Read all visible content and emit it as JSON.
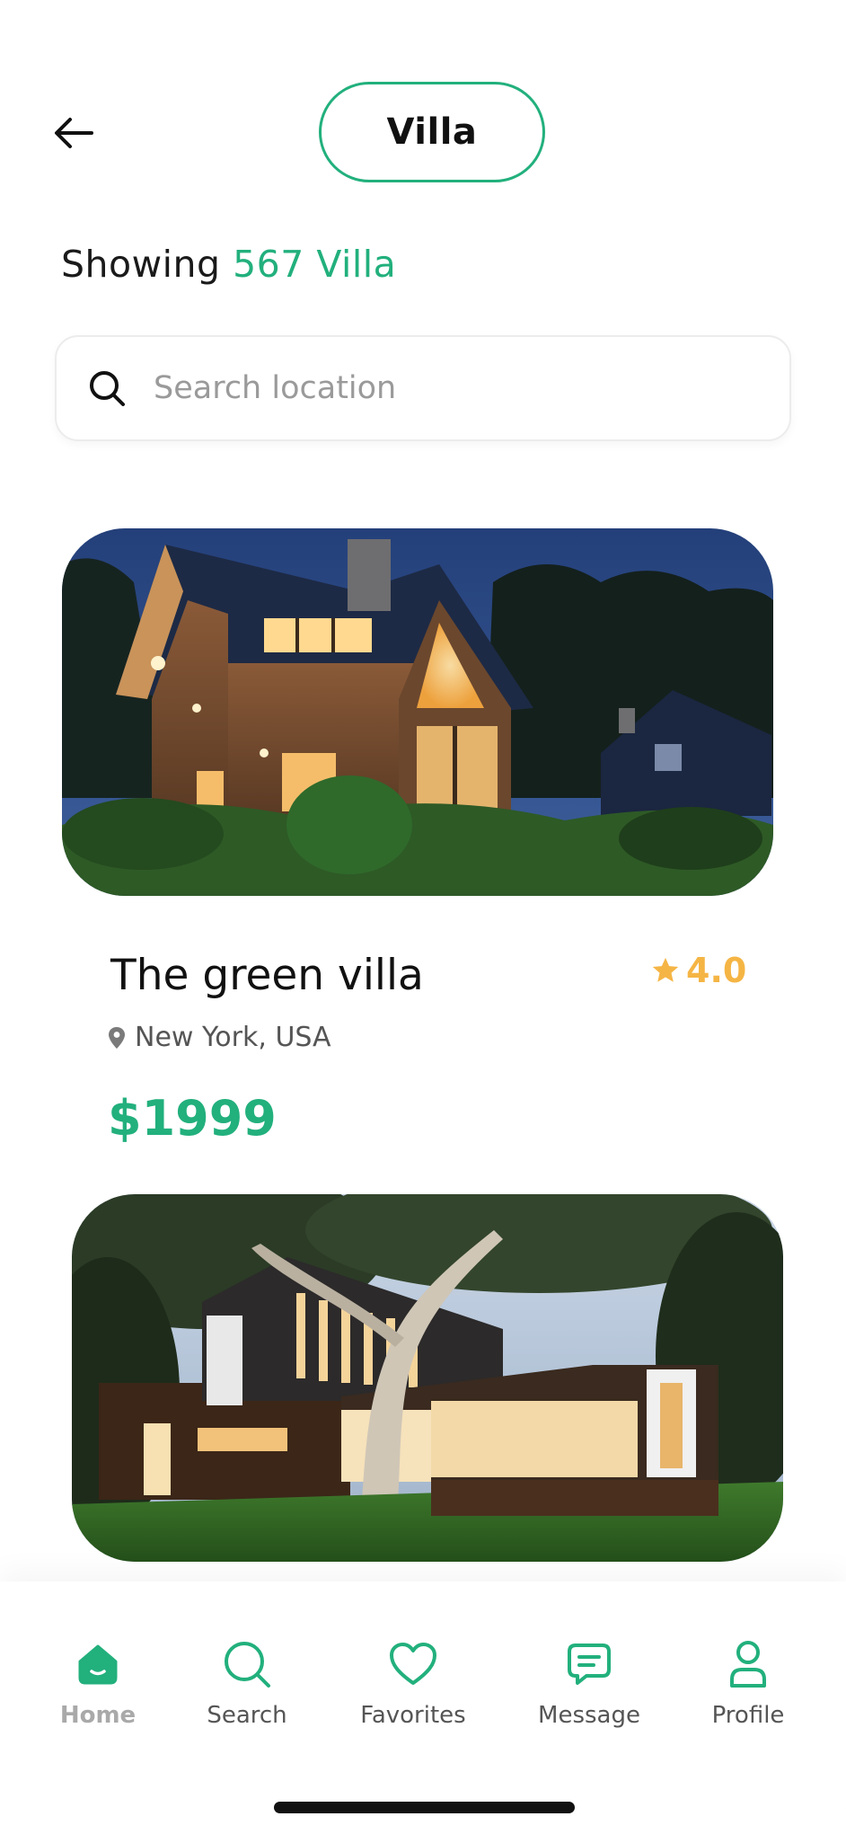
{
  "header": {
    "title": "Villa"
  },
  "summary": {
    "prefix": "Showing",
    "count": "567 Villa"
  },
  "search": {
    "placeholder": "Search location"
  },
  "listings": [
    {
      "name": "The green villa",
      "rating": "4.0",
      "location": "New York, USA",
      "price": "$1999"
    }
  ],
  "icons": {
    "back": "arrow-left-icon",
    "search": "search-icon",
    "star": "star-icon",
    "location": "location-pin-icon",
    "home": "home-icon",
    "favorites": "heart-icon",
    "message": "message-icon",
    "profile": "user-icon"
  },
  "nav": {
    "items": [
      {
        "label": "Home",
        "active": true
      },
      {
        "label": "Search",
        "active": false
      },
      {
        "label": "Favorites",
        "active": false
      },
      {
        "label": "Message",
        "active": false
      },
      {
        "label": "Profile",
        "active": false
      }
    ]
  },
  "colors": {
    "accent": "#22b07d",
    "rating": "#f5b545",
    "text": "#111111",
    "muted": "#9a9a9a"
  }
}
